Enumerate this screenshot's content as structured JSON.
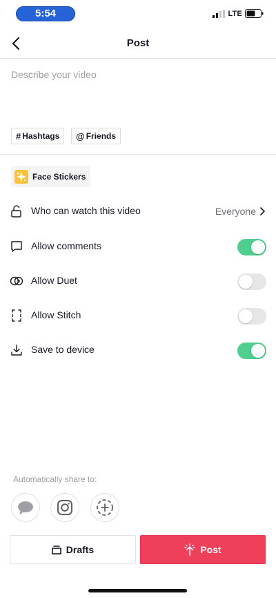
{
  "status_bar": {
    "time": "5:54",
    "network": "LTE"
  },
  "header": {
    "title": "Post"
  },
  "caption": {
    "placeholder": "Describe your video"
  },
  "tags": {
    "hashtags_symbol": "#",
    "hashtags_label": "Hashtags",
    "friends_symbol": "@",
    "friends_label": "Friends"
  },
  "stickers": {
    "label": "Face Stickers"
  },
  "settings": [
    {
      "label": "Who can watch this video",
      "value": "Everyone",
      "icon": "lock-icon"
    },
    {
      "label": "Allow comments",
      "enabled": true,
      "icon": "comment-icon"
    },
    {
      "label": "Allow Duet",
      "enabled": false,
      "icon": "duet-icon"
    },
    {
      "label": "Allow Stitch",
      "enabled": false,
      "icon": "stitch-icon"
    },
    {
      "label": "Save to device",
      "enabled": true,
      "icon": "download-icon"
    }
  ],
  "share": {
    "label": "Automatically share to:",
    "targets": [
      "messages-icon",
      "instagram-icon",
      "story-add-icon"
    ]
  },
  "actions": {
    "drafts_label": "Drafts",
    "post_label": "Post"
  },
  "colors": {
    "accent": "#ee3f5b",
    "toggle_on": "#4fcf8d",
    "toggle_off": "#e6e6e8",
    "time_pill": "#2563d6"
  }
}
